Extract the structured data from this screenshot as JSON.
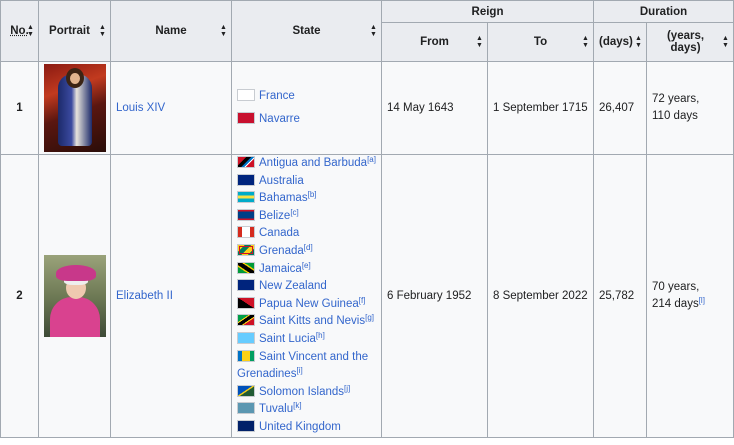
{
  "headers": {
    "no": "No.",
    "portrait": "Portrait",
    "name": "Name",
    "state": "State",
    "reign": "Reign",
    "from": "From",
    "to": "To",
    "duration": "Duration",
    "days": "(days)",
    "years_days_1": "(years,",
    "years_days_2": "days)"
  },
  "rows": [
    {
      "no": "1",
      "portrait_icon": "louis-xiv-portrait",
      "name": "Louis XIV",
      "states": [
        {
          "name": "France",
          "flag": "flag-france-royal",
          "note": ""
        },
        {
          "name": "Navarre",
          "flag": "flag-navarre",
          "note": ""
        }
      ],
      "from": "14 May 1643",
      "to": "1 September 1715",
      "days": "26,407",
      "years_line1": "72 years,",
      "years_line2": "110 days",
      "years_note": ""
    },
    {
      "no": "2",
      "portrait_icon": "elizabeth-ii-portrait",
      "name": "Elizabeth II",
      "states": [
        {
          "name": "Antigua and Barbuda",
          "flag": "flag-antigua",
          "note": "[a]"
        },
        {
          "name": "Australia",
          "flag": "flag-australia",
          "note": ""
        },
        {
          "name": "Bahamas",
          "flag": "flag-bahamas",
          "note": "[b]"
        },
        {
          "name": "Belize",
          "flag": "flag-belize",
          "note": "[c]"
        },
        {
          "name": "Canada",
          "flag": "flag-canada",
          "note": ""
        },
        {
          "name": "Grenada",
          "flag": "flag-grenada",
          "note": "[d]"
        },
        {
          "name": "Jamaica",
          "flag": "flag-jamaica",
          "note": "[e]"
        },
        {
          "name": "New Zealand",
          "flag": "flag-new-zealand",
          "note": ""
        },
        {
          "name": "Papua New Guinea",
          "flag": "flag-papua-new-guinea",
          "note": "[f]"
        },
        {
          "name": "Saint Kitts and Nevis",
          "flag": "flag-saint-kitts",
          "note": "[g]"
        },
        {
          "name": "Saint Lucia",
          "flag": "flag-saint-lucia",
          "note": "[h]"
        },
        {
          "name": "Saint Vincent and the Grenadines",
          "flag": "flag-saint-vincent",
          "note": "[i]"
        },
        {
          "name": "Solomon Islands",
          "flag": "flag-solomon-islands",
          "note": "[j]"
        },
        {
          "name": "Tuvalu",
          "flag": "flag-tuvalu",
          "note": "[k]"
        },
        {
          "name": "United Kingdom",
          "flag": "flag-united-kingdom",
          "note": ""
        }
      ],
      "from": "6 February 1952",
      "to": "8 September 2022",
      "days": "25,782",
      "years_line1": "70 years,",
      "years_line2": "214 days",
      "years_note": "[l]"
    }
  ],
  "colors": {
    "link": "#3366cc",
    "header_bg": "#eaecf0",
    "cell_bg": "#f8f9fa",
    "border": "#a2a9b1"
  },
  "flag_styles": {
    "flag-france-royal": "background:#ffffff",
    "flag-navarre": "background:#c8102e",
    "flag-antigua": "background:linear-gradient(135deg,#ce1126 32%,#000 32%,#000 50%,#0072c6 50%,#0072c6 62%,#fff 62%,#fff 68%,#ce1126 68%)",
    "flag-australia": "background:#00247d",
    "flag-bahamas": "background:linear-gradient(180deg,#00abc9 33%,#fae042 33%,#fae042 67%,#00abc9 67%)",
    "flag-belize": "background:linear-gradient(180deg,#ce1126 14%,#003f87 14%,#003f87 86%,#ce1126 86%)",
    "flag-canada": "background:linear-gradient(90deg,#d52b1e 25%,#fff 25%,#fff 75%,#d52b1e 75%)",
    "flag-grenada": "background:linear-gradient(135deg,#fcd116 25%,#007a5e 25%,#007a5e 50%,#fcd116 50%,#fcd116 75%,#007a5e 75%);outline:1px solid #ce1126;outline-offset:-3px",
    "flag-jamaica": "background:linear-gradient(33deg,#009b3a 30%,#fed100 30%,#fed100 38%,#000 38%,#000 62%,#fed100 62%,#fed100 70%,#009b3a 70%)",
    "flag-new-zealand": "background:#00247d",
    "flag-papua-new-guinea": "background:linear-gradient(33deg,#000 50%,#ce1126 50%)",
    "flag-saint-kitts": "background:linear-gradient(146deg,#009e49 34%,#fcd116 34%,#fcd116 40%,#000 40%,#000 60%,#fcd116 60%,#fcd116 66%,#ce1126 66%)",
    "flag-saint-lucia": "background:#66ccff",
    "flag-saint-vincent": "background:linear-gradient(90deg,#0072c6 25%,#fcd116 25%,#fcd116 75%,#009e60 75%)",
    "flag-solomon-islands": "background:linear-gradient(146deg,#0051ba 46%,#fcd116 46%,#fcd116 54%,#215b33 54%)",
    "flag-tuvalu": "background:#5b97b1",
    "flag-united-kingdom": "background:#012169"
  }
}
